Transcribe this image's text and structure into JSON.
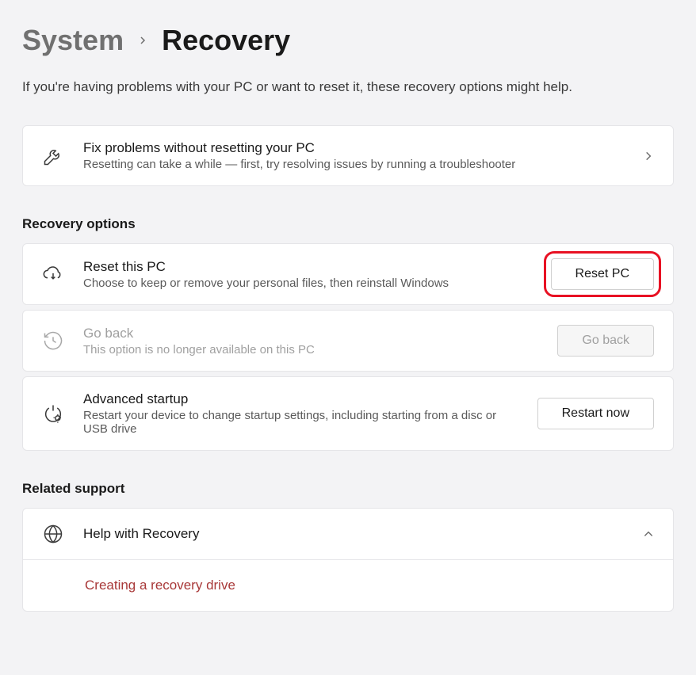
{
  "breadcrumb": {
    "parent": "System",
    "current": "Recovery"
  },
  "subtitle": "If you're having problems with your PC or want to reset it, these recovery options might help.",
  "fix_problems": {
    "title": "Fix problems without resetting your PC",
    "desc": "Resetting can take a while — first, try resolving issues by running a troubleshooter"
  },
  "sections": {
    "recovery_options": "Recovery options",
    "related_support": "Related support"
  },
  "reset_pc": {
    "title": "Reset this PC",
    "desc": "Choose to keep or remove your personal files, then reinstall Windows",
    "button": "Reset PC"
  },
  "go_back": {
    "title": "Go back",
    "desc": "This option is no longer available on this PC",
    "button": "Go back"
  },
  "advanced_startup": {
    "title": "Advanced startup",
    "desc": "Restart your device to change startup settings, including starting from a disc or USB drive",
    "button": "Restart now"
  },
  "support": {
    "title": "Help with Recovery",
    "link": "Creating a recovery drive"
  }
}
